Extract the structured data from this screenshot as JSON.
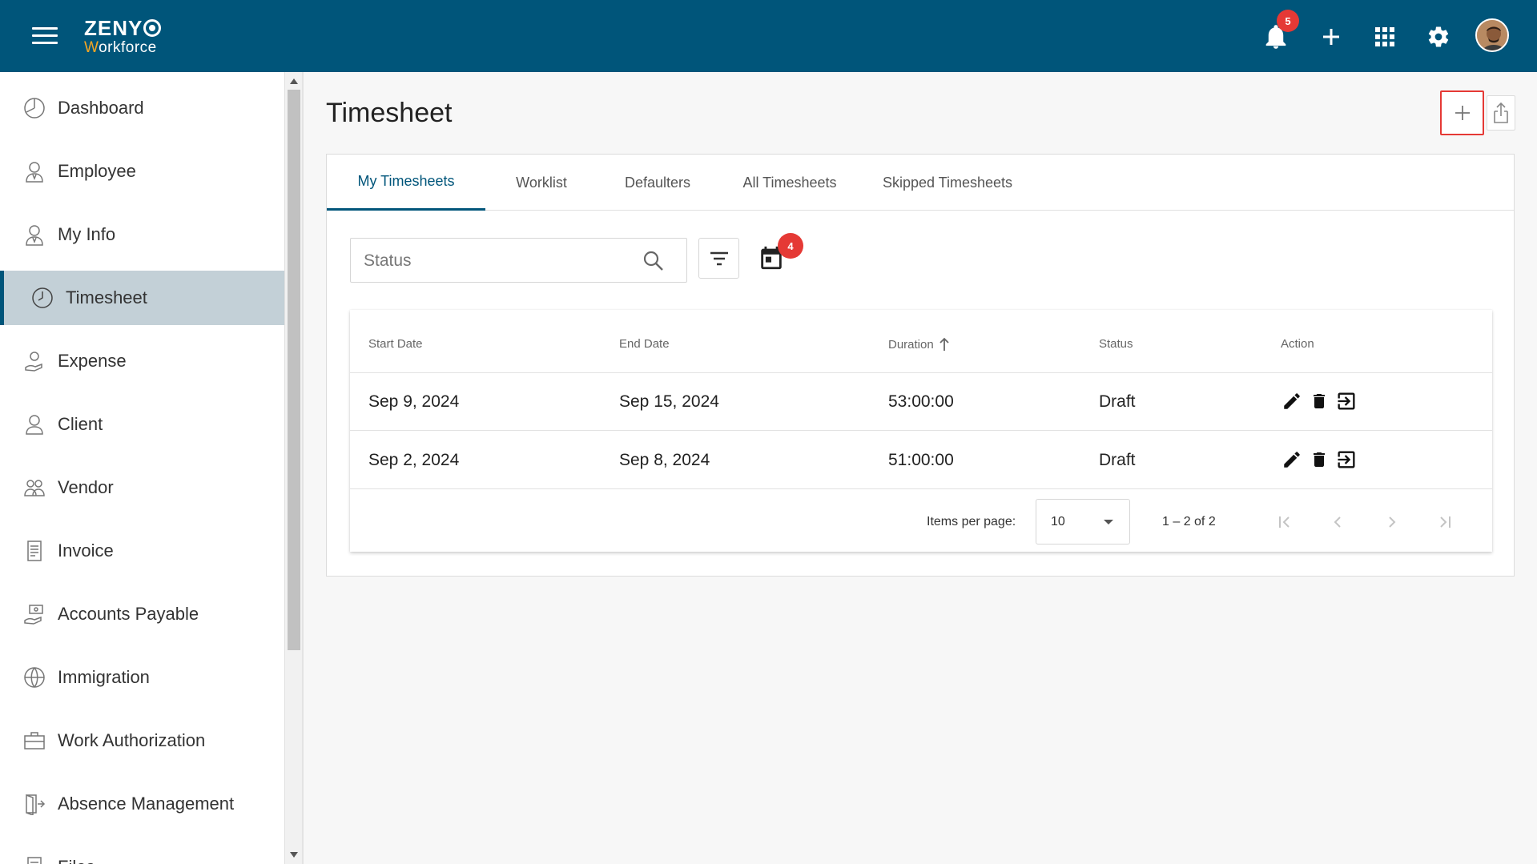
{
  "header": {
    "logo_top": "ZENY",
    "logo_bottom_first": "W",
    "logo_bottom_rest": "orkforce",
    "notifications_count": "5"
  },
  "sidebar": {
    "items": [
      {
        "label": "Dashboard",
        "icon": "dashboard-icon"
      },
      {
        "label": "Employee",
        "icon": "employee-icon"
      },
      {
        "label": "My Info",
        "icon": "my-info-icon"
      },
      {
        "label": "Timesheet",
        "icon": "clock-icon",
        "active": true
      },
      {
        "label": "Expense",
        "icon": "expense-icon"
      },
      {
        "label": "Client",
        "icon": "client-icon"
      },
      {
        "label": "Vendor",
        "icon": "vendor-icon"
      },
      {
        "label": "Invoice",
        "icon": "invoice-icon"
      },
      {
        "label": "Accounts Payable",
        "icon": "accounts-payable-icon"
      },
      {
        "label": "Immigration",
        "icon": "globe-icon"
      },
      {
        "label": "Work Authorization",
        "icon": "briefcase-icon"
      },
      {
        "label": "Absence Management",
        "icon": "door-icon"
      },
      {
        "label": "Files",
        "icon": "files-icon"
      }
    ]
  },
  "main": {
    "title": "Timesheet",
    "tabs": [
      "My Timesheets",
      "Worklist",
      "Defaulters",
      "All Timesheets",
      "Skipped Timesheets"
    ],
    "search_placeholder": "Status",
    "calendar_badge": "4",
    "table": {
      "columns": [
        "Start Date",
        "End Date",
        "Duration",
        "Status",
        "Action"
      ],
      "rows": [
        {
          "start": "Sep 9, 2024",
          "end": "Sep 15, 2024",
          "duration": "53:00:00",
          "status": "Draft"
        },
        {
          "start": "Sep 2, 2024",
          "end": "Sep 8, 2024",
          "duration": "51:00:00",
          "status": "Draft"
        }
      ]
    },
    "pager": {
      "items_per_page_label": "Items per page:",
      "page_size": "10",
      "range": "1 – 2 of 2"
    }
  },
  "colors": {
    "brand": "#00557a",
    "accent": "#f5a623",
    "badge": "#e53935",
    "active_nav": "#c3d0d7"
  }
}
